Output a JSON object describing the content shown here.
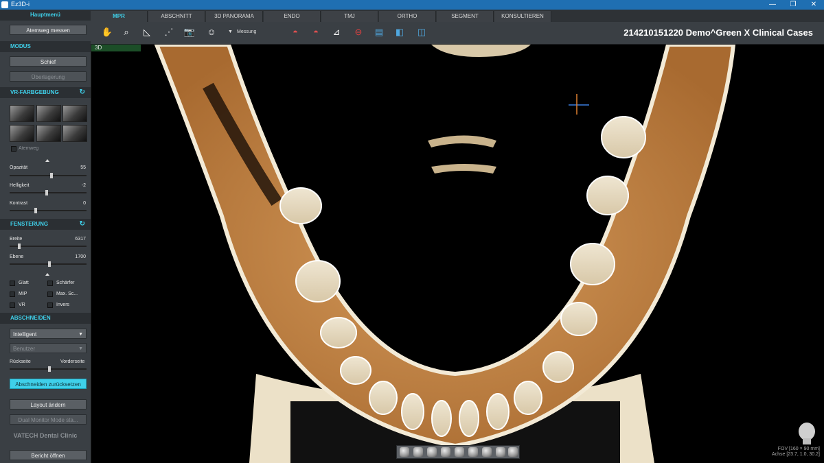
{
  "window": {
    "title": "Ez3D-i",
    "controls": [
      "—",
      "❐",
      "✕"
    ]
  },
  "sidebar": {
    "main_menu": "Hauptmenü",
    "airway_button": "Atemweg messen",
    "modus": {
      "header": "MODUS",
      "oblique": "Schief",
      "overlay": "Überlagerung"
    },
    "vr_coloring": {
      "header": "VR-FARBGEBUNG",
      "presets": [
        "skull-preset-icon",
        "face-preset-icon",
        "bone-preset-icon",
        "soft-tissue-preset-icon",
        "muscle-preset-icon",
        "gear-preset-icon"
      ],
      "airway_check": "Atemweg",
      "opacity_label": "Opazität",
      "opacity_value": "55",
      "opacity_level": 0.55,
      "brightness_label": "Helligkeit",
      "brightness_value": "-2",
      "brightness_level": 0.48,
      "contrast_label": "Kontrast",
      "contrast_value": "0",
      "contrast_level": 0.33
    },
    "windowing": {
      "header": "FENSTERUNG",
      "width_label": "Breite",
      "width_value": "6317",
      "width_level": 0.11,
      "level_label": "Ebene",
      "level_value": "1700",
      "level_level": 0.52,
      "options": [
        "Glatt",
        "Schärfer",
        "MIP",
        "Max. Sc...",
        "VR",
        "Invers"
      ]
    },
    "clipping": {
      "header": "ABSCHNEIDEN",
      "mode": "Intelligent",
      "user": "Benutzer",
      "back_label": "Rückseite",
      "front_label": "Vorderseite",
      "clip_level": 0.52,
      "reset_button": "Abschneiden zurücksetzen"
    },
    "change_layout": "Layout ändern",
    "dual_monitor": "Dual Monitor Mode sta...",
    "brand": "VATECH Dental Clinic",
    "open_report": "Bericht öffnen"
  },
  "tabs": [
    "MPR",
    "ABSCHNITT",
    "3D PANORAMA",
    "ENDO",
    "TMJ",
    "ORTHO",
    "SEGMENT",
    "KONSULTIEREN"
  ],
  "active_tab": "MPR",
  "toolbar": {
    "tools": [
      "hand-icon",
      "magnifier-icon",
      "angle-icon",
      "polyline-icon",
      "camera-icon",
      "annotate-icon"
    ],
    "measure_label": "Messung",
    "tools2": [
      "skull-arc-icon",
      "skull-arc-red-icon",
      "measure-angle-icon",
      "stop-icon",
      "panorama-icon",
      "cross-section-icon",
      "volume-icon"
    ]
  },
  "patient": "214210151220  Demo^Green X Clinical Cases",
  "viewer": {
    "tag": "3D",
    "fov_line": "FOV [160 × 90 mm]",
    "axis_line": "Achse [23.7, 1.0, 30.2]"
  },
  "colors": {
    "accent": "#3fd0ea",
    "panel": "#3a3f44",
    "bone": "#e8dcc4",
    "tissue": "#c98a4a"
  }
}
